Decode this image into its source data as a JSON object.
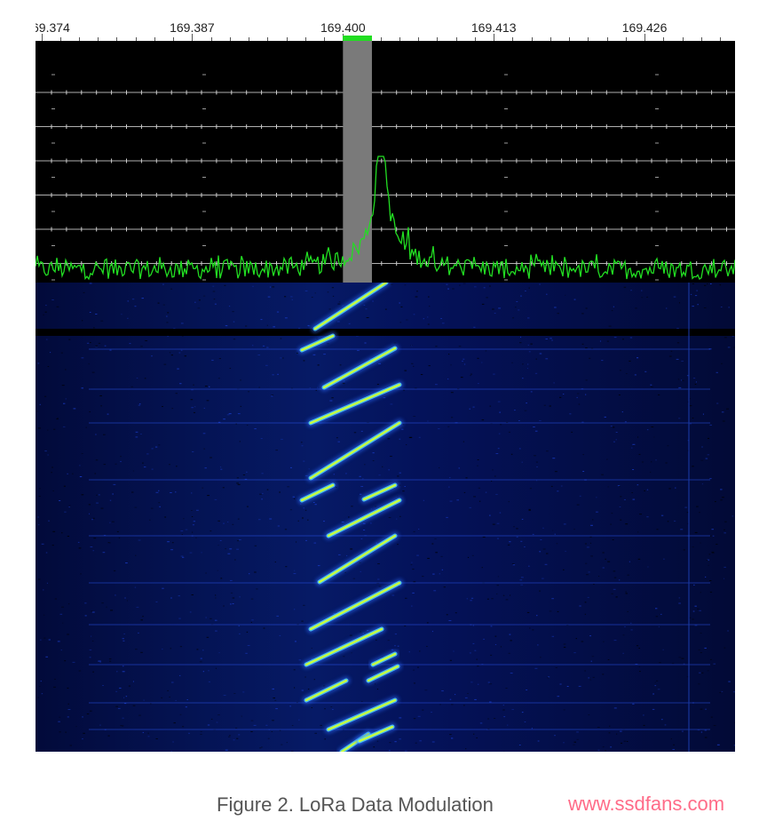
{
  "frequency_ruler": {
    "labels": [
      {
        "text": "69.374",
        "freq_mhz": 169.374
      },
      {
        "text": "169.387",
        "freq_mhz": 169.387
      },
      {
        "text": "169.400",
        "freq_mhz": 169.4
      },
      {
        "text": "169.413",
        "freq_mhz": 169.413
      },
      {
        "text": "169.426",
        "freq_mhz": 169.426
      }
    ],
    "start_mhz": 169.3735,
    "end_mhz": 169.4338
  },
  "tuned_channel": {
    "start_mhz": 169.4,
    "end_mhz": 169.4025,
    "bar_color": "#22dd22",
    "band_color": "#7a7a7a"
  },
  "spectrum": {
    "trace_color": "#22dd22",
    "grid_color": "#cfcfcf",
    "peak_mhz": 169.4033
  },
  "waterfall": {
    "background_color": "#000c33",
    "chirp_color": "#c8ff40"
  },
  "caption": "Figure 2. LoRa Data Modulation",
  "watermark": "www.ssdfans.com"
}
